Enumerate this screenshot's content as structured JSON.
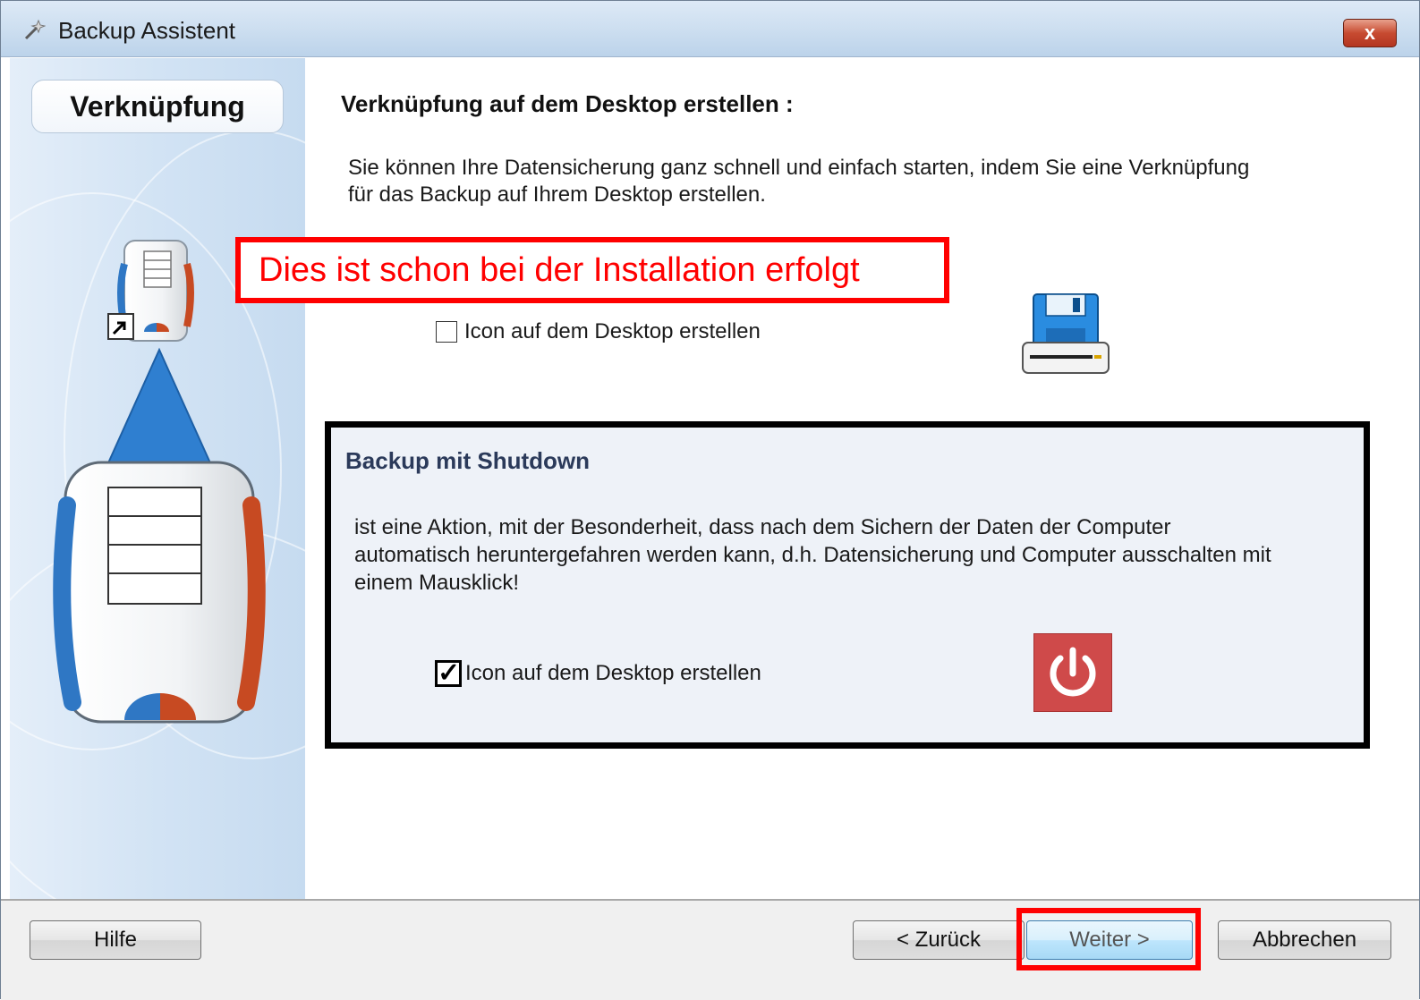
{
  "window": {
    "title": "Backup Assistent",
    "close_label": "x"
  },
  "sidebar": {
    "step_label": "Verknüpfung"
  },
  "main": {
    "heading": "Verknüpfung auf dem Desktop erstellen :",
    "description_line1": "Sie können Ihre Datensicherung ganz schnell und einfach starten, indem Sie eine Verknüpfung",
    "description_line2": "für das Backup auf Ihrem Desktop erstellen.",
    "desktop_icon": {
      "label": "Icon auf dem Desktop erstellen",
      "checked": false,
      "icon": "floppy-drive-icon"
    }
  },
  "annotation": {
    "text": "Dies ist schon bei der Installation erfolgt",
    "color": "#ff0000"
  },
  "shutdown": {
    "title": "Backup mit Shutdown",
    "text_line1": "ist eine Aktion, mit der Besonderheit, dass nach dem Sichern der Daten  der Computer",
    "text_line2": "automatisch heruntergefahren werden kann, d.h. Datensicherung und Computer ausschalten mit",
    "text_line3": "einem Mausklick!",
    "checkbox": {
      "label": "Icon auf dem Desktop erstellen",
      "checked": true
    },
    "icon": "power-icon",
    "icon_color": "#cf4a4a"
  },
  "footer": {
    "help_label": "Hilfe",
    "back_label": "< Zurück",
    "next_label": "Weiter >",
    "cancel_label": "Abbrechen"
  }
}
